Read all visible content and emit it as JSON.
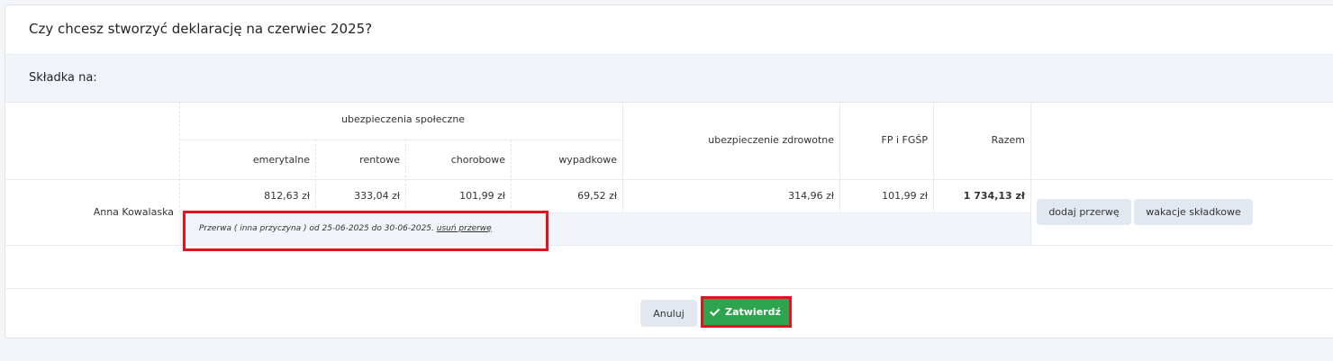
{
  "dialog": {
    "title": "Czy chcesz stworzyć deklarację na czerwiec 2025?",
    "section_label": "Składka na:"
  },
  "table": {
    "group_header": "ubezpieczenia społeczne",
    "sub_headers": [
      "emerytalne",
      "rentowe",
      "chorobowe",
      "wypadkowe"
    ],
    "health_header": "ubezpieczenie zdrowotne",
    "fp_header": "FP i FGŚP",
    "total_header": "Razem",
    "row": {
      "name": "Anna Kowalaska",
      "emerytalne": "812,63 zł",
      "rentowe": "333,04 zł",
      "chorobowe": "101,99 zł",
      "wypadkowe": "69,52 zł",
      "zdrowotne": "314,96 zł",
      "fp": "101,99 zł",
      "razem": "1 734,13 zł"
    },
    "break_text": "Przerwa ( inna przyczyna ) od 25-06-2025 do 30-06-2025.",
    "break_link": "usuń przerwę",
    "row_actions": {
      "add_break": "dodaj przerwę",
      "holiday": "wakacje składkowe"
    }
  },
  "footer": {
    "cancel": "Anuluj",
    "confirm": "Zatwierdź"
  },
  "colors": {
    "confirm": "#2ea44f",
    "highlight": "#e0141e",
    "secondary_button": "#e2e8ef"
  }
}
